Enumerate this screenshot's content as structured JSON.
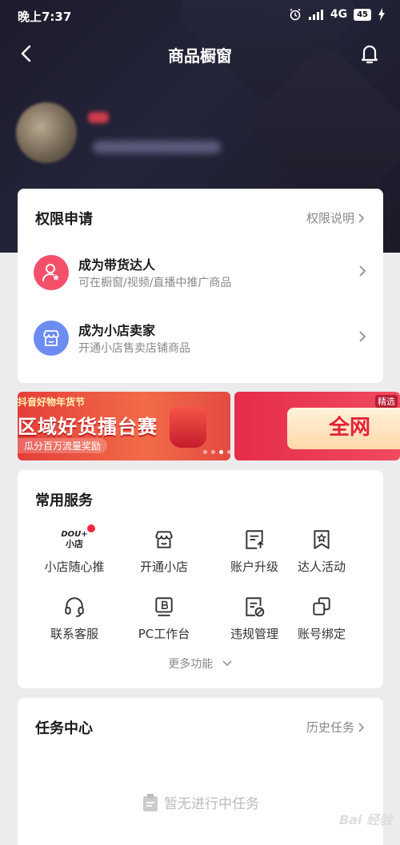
{
  "status_bar": {
    "time": "晚上7:37",
    "network": "4G",
    "battery": "45"
  },
  "nav": {
    "title": "商品橱窗"
  },
  "permission_card": {
    "title": "权限申请",
    "link": "权限说明",
    "items": [
      {
        "title": "成为带货达人",
        "subtitle": "可在橱窗/视频/直播中推广商品",
        "icon": "user-star-icon",
        "color": "#f4506a"
      },
      {
        "title": "成为小店卖家",
        "subtitle": "开通小店售卖店铺商品",
        "icon": "shop-icon",
        "color": "#6d8cf2"
      }
    ]
  },
  "banners": {
    "first": {
      "top": "抖音好物年货节",
      "main": "区域好货擂台赛",
      "sub": "瓜分百万流量奖励"
    },
    "second": {
      "small": "精选",
      "main": "全网"
    }
  },
  "services_card": {
    "title": "常用服务",
    "logo_top": "DOU+",
    "logo_bottom": "小店",
    "items": [
      {
        "label": "小店随心推",
        "icon": "dou-plus-icon"
      },
      {
        "label": "开通小店",
        "icon": "shop-icon"
      },
      {
        "label": "账户升级",
        "icon": "account-upgrade-icon"
      },
      {
        "label": "达人活动",
        "icon": "bookmark-star-icon"
      },
      {
        "label": "联系客服",
        "icon": "headset-icon"
      },
      {
        "label": "PC工作台",
        "icon": "pc-workbench-icon"
      },
      {
        "label": "违规管理",
        "icon": "violation-doc-icon"
      },
      {
        "label": "账号绑定",
        "icon": "account-link-icon"
      }
    ],
    "more": "更多功能"
  },
  "task_card": {
    "title": "任务中心",
    "link": "历史任务",
    "empty": "暂无进行中任务"
  },
  "watermark": "Bai 经验"
}
